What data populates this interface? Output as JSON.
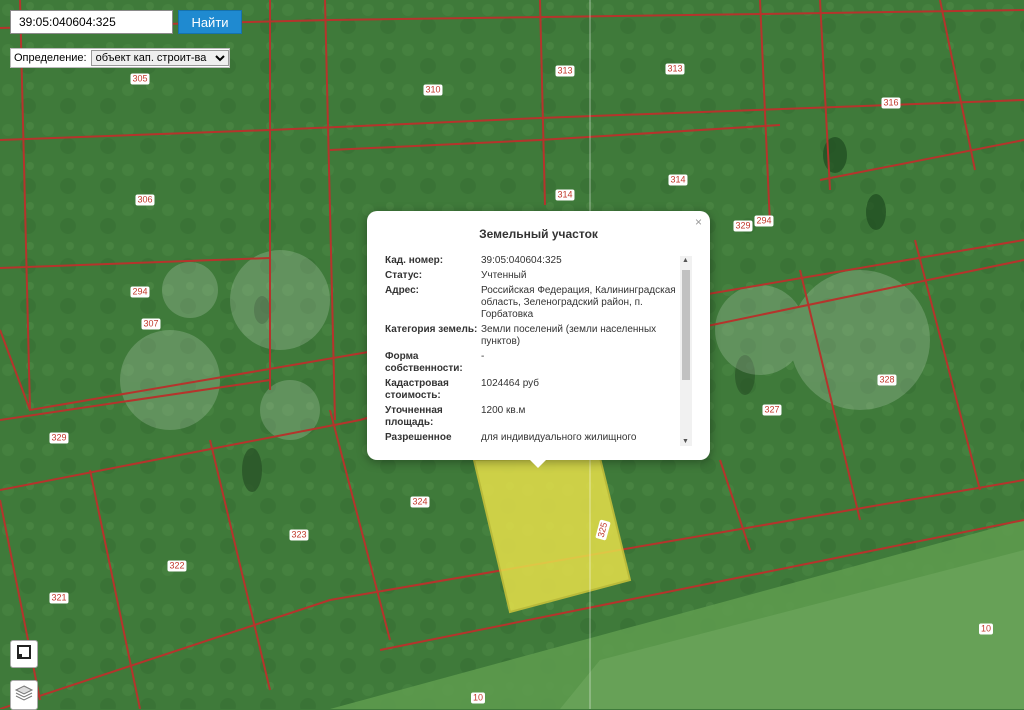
{
  "search": {
    "value": "39:05:040604:325",
    "button_label": "Найти"
  },
  "filter": {
    "label": "Определение:",
    "selected": "объект кап. строит-ва"
  },
  "popup": {
    "title": "Земельный участок",
    "close": "×",
    "rows": [
      {
        "key": "Кад. номер:",
        "value": "39:05:040604:325"
      },
      {
        "key": "Статус:",
        "value": "Учтенный"
      },
      {
        "key": "Адрес:",
        "value": "Российская Федерация, Калининградская область, Зеленоградский район, п. Горбатовка"
      },
      {
        "key": "Категория земель:",
        "value": "Земли поселений (земли населенных пунктов)"
      },
      {
        "key": "Форма собственности:",
        "value": "-"
      },
      {
        "key": "Кадастровая стоимость:",
        "value": "1024464 руб"
      },
      {
        "key": "Уточненная площадь:",
        "value": "1200 кв.м"
      },
      {
        "key": "Разрешенное",
        "value": "для индивидуального жилищного"
      }
    ]
  },
  "map": {
    "parcel_labels": [
      "305",
      "313",
      "313",
      "310",
      "316",
      "306",
      "314",
      "314",
      "329",
      "294",
      "294",
      "307",
      "328",
      "327",
      "329",
      "324",
      "323",
      "322",
      "321",
      "325",
      "10",
      "10"
    ],
    "colors": {
      "boundary": "#b5342c",
      "highlight": "#e6e04a",
      "vegetation": "#3f7a3a"
    }
  },
  "controls": {
    "layers_icon": "layers-icon",
    "square_icon": "square-icon"
  }
}
